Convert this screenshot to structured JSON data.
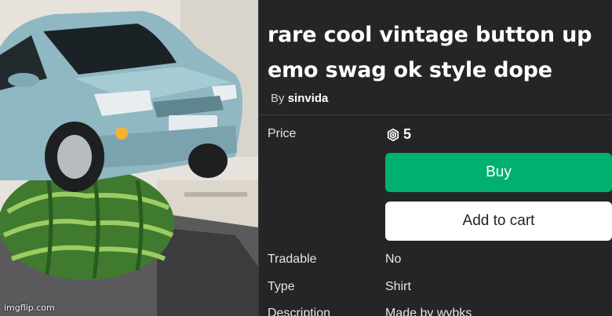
{
  "item": {
    "title": "rare cool vintage button up emo swag ok style dope",
    "by_prefix": "By",
    "creator": "sinvida"
  },
  "image": {
    "watermark": "imgflip.com"
  },
  "purchase": {
    "price_label": "Price",
    "price_value": "5",
    "currency_icon": "robux-icon",
    "buy_label": "Buy",
    "cart_label": "Add to cart"
  },
  "details": {
    "tradable_label": "Tradable",
    "tradable_value": "No",
    "type_label": "Type",
    "type_value": "Shirt",
    "description_label": "Description",
    "description_value": "Made by wybks"
  },
  "colors": {
    "background": "#232527",
    "buy_button": "#00b06f",
    "cart_button": "#ffffff"
  }
}
